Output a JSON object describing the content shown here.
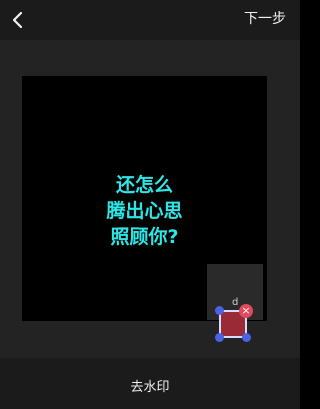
{
  "header": {
    "back_icon": "chevron-left-icon",
    "next_label": "下一步"
  },
  "canvas": {
    "caption_lines": [
      "还怎么",
      "腾出心思",
      "照顾你?"
    ],
    "caption_color": "#2ee6e6",
    "watermark_logo": "d",
    "selection_color": "#9a2b34",
    "handle_color": "#4a63e6",
    "delete_color": "#e04a5a",
    "delete_icon": "close-icon"
  },
  "footer": {
    "action_label": "去水印"
  }
}
